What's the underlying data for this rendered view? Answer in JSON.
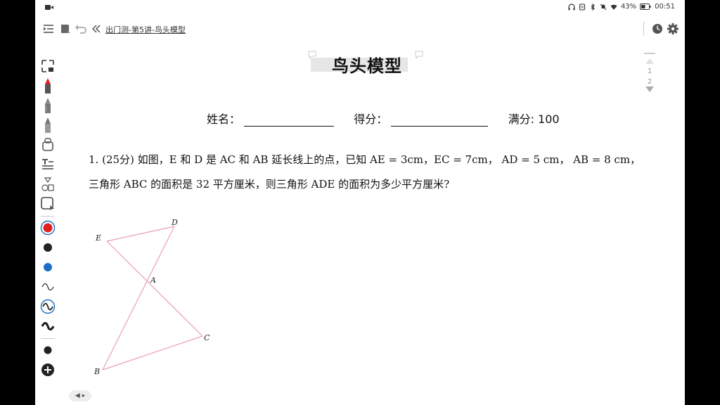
{
  "status_bar": {
    "battery": "43%",
    "time": "00:51"
  },
  "toolbar": {
    "breadcrumb": "出门测-第5讲-鸟头模型"
  },
  "page_nav": {
    "pages": [
      "1",
      "2"
    ]
  },
  "document": {
    "title": "鸟头模型",
    "name_label": "姓名：",
    "score_label": "得分：",
    "full_score_label": "满分: 100",
    "question": {
      "number": "1.",
      "points": "(25分)",
      "line1": "如图，E 和 D 是 AC 和 AB 延长线上的点，已知 AE = 3cm，EC = 7cm， AD = 5 cm， AB = 8 cm，",
      "line2": "三角形 ABC 的面积是 32 平方厘米，则三角形 ADE 的面积为多少平方厘米?"
    },
    "figure": {
      "labels": {
        "D": "D",
        "E": "E",
        "A": "A",
        "C": "C",
        "B": "B"
      },
      "line_color": "#e8a0b0"
    }
  },
  "palette": {
    "accent_red": "#e02020",
    "accent_blue": "#1a6fc4"
  }
}
